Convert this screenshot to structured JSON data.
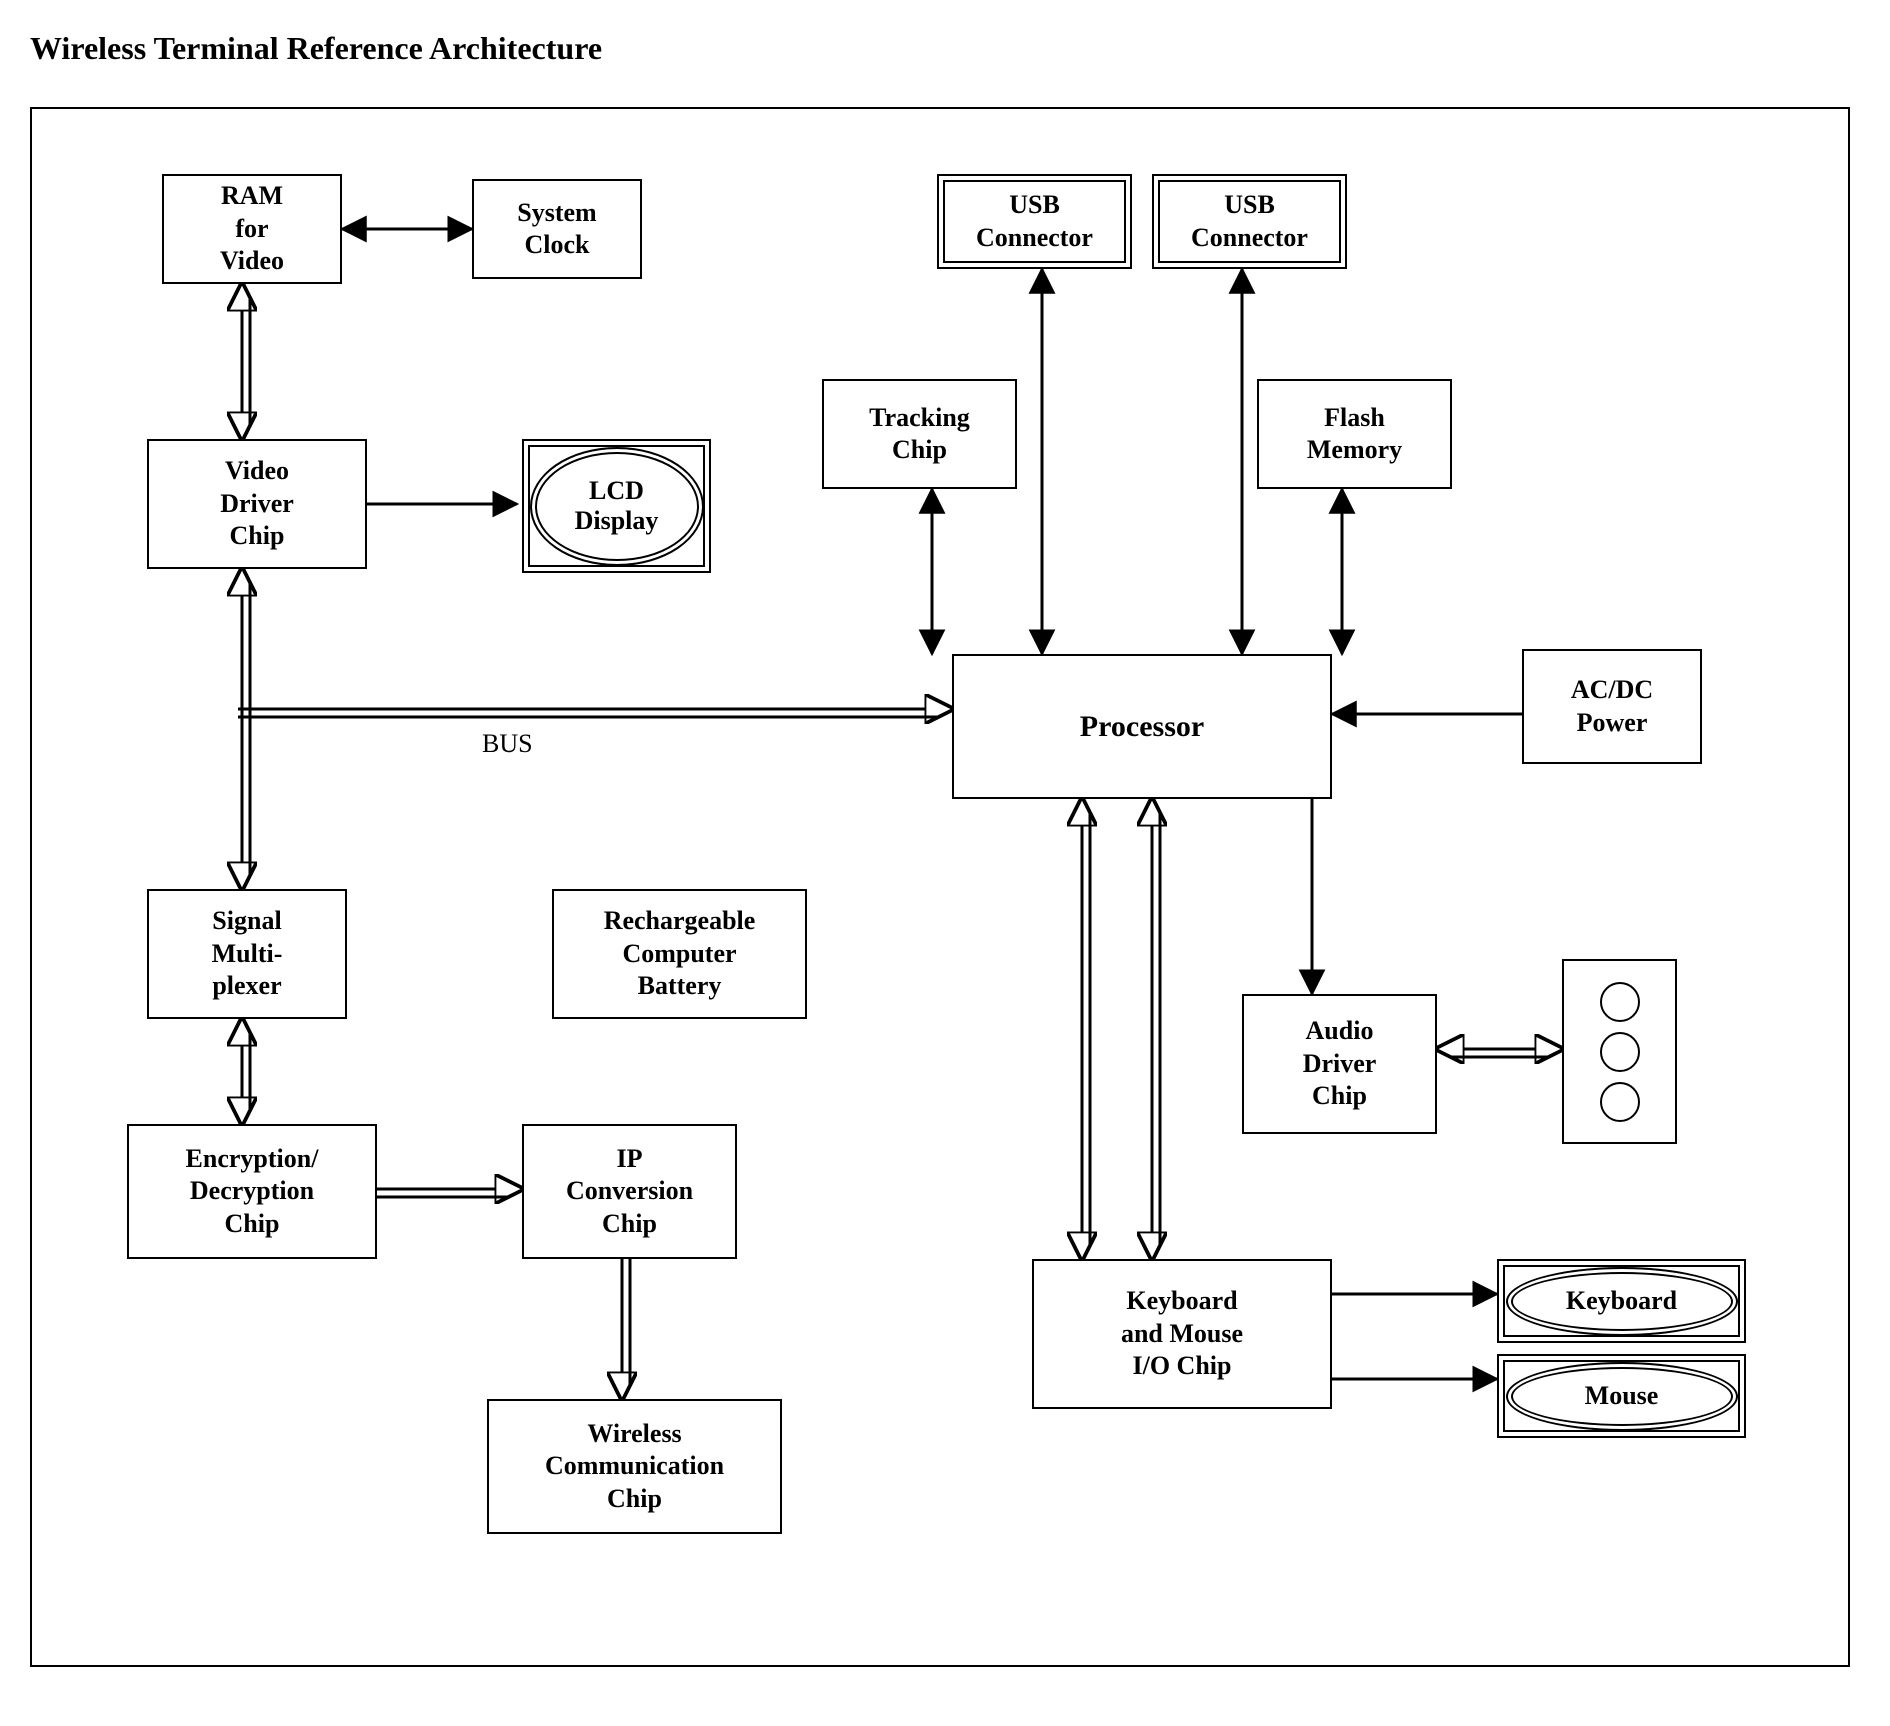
{
  "title": "Wireless Terminal Reference Architecture",
  "bus_label": "BUS",
  "blocks": {
    "ram": "RAM\nfor\nVideo",
    "sysclock": "System\nClock",
    "usb1": "USB\nConnector",
    "usb2": "USB\nConnector",
    "tracking": "Tracking\nChip",
    "flash": "Flash\nMemory",
    "vdriver": "Video\nDriver\nChip",
    "lcd": "LCD\nDisplay",
    "processor": "Processor",
    "acdc": "AC/DC\nPower",
    "sigmux": "Signal\nMulti-\nplexer",
    "battery": "Rechargeable\nComputer\nBattery",
    "audio": "Audio\nDriver\nChip",
    "encdec": "Encryption/\nDecryption\nChip",
    "ipconv": "IP\nConversion\nChip",
    "kbmouse": "Keyboard\nand Mouse\nI/O Chip",
    "keyboard": "Keyboard",
    "mouse": "Mouse",
    "wireless": "Wireless\nCommunication\nChip"
  }
}
